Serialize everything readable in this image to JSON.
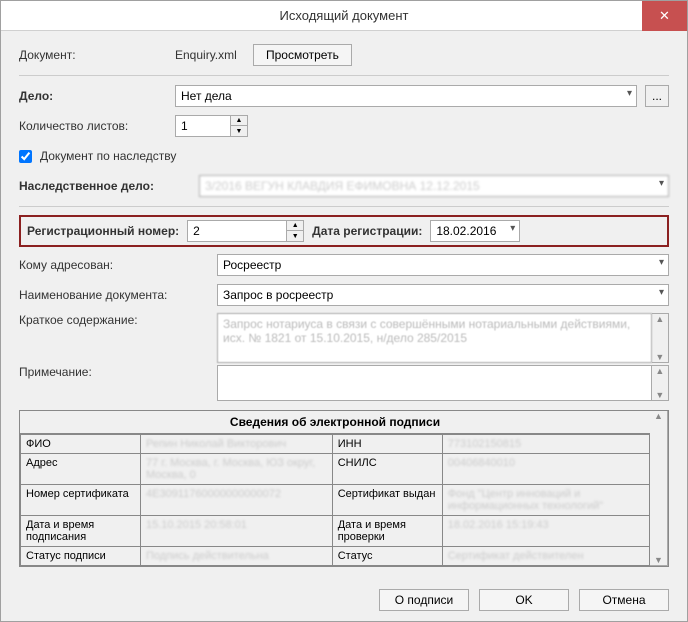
{
  "window": {
    "title": "Исходящий документ"
  },
  "doc": {
    "label": "Документ:",
    "filename": "Enquiry.xml",
    "view_btn": "Просмотреть"
  },
  "case": {
    "label": "Дело:",
    "value": "Нет дела"
  },
  "sheets": {
    "label": "Количество листов:",
    "value": "1"
  },
  "inherit": {
    "label": "Документ по наследству"
  },
  "inherit_case": {
    "label": "Наследственное дело:",
    "value": "3/2016 ВЕГУН КЛАВДИЯ ЕФИМОВНА 12.12.2015"
  },
  "reg": {
    "num_label": "Регистрационный номер:",
    "num_value": "2",
    "date_label": "Дата регистрации:",
    "date_value": "18.02.2016"
  },
  "addr": {
    "label": "Кому адресован:",
    "value": "Росреестр"
  },
  "docname": {
    "label": "Наименование документа:",
    "value": "Запрос в росреестр"
  },
  "summary": {
    "label": "Краткое содержание:",
    "value": "Запрос нотариуса в связи с совершёнными нотариальными действиями, исх. № 1821 от 15.10.2015, н/дело 285/2015"
  },
  "note": {
    "label": "Примечание:",
    "value": ""
  },
  "sig": {
    "title": "Сведения об электронной подписи",
    "rows": [
      {
        "l1": "ФИО",
        "v1": "Репин Николай Викторович",
        "l2": "ИНН",
        "v2": "773102150815"
      },
      {
        "l1": "Адрес",
        "v1": "77 г. Москва, г. Москва, ЮЗ округ, Москва, 0",
        "l2": "СНИЛС",
        "v2": "00406840010"
      },
      {
        "l1": "Номер сертификата",
        "v1": "4E30911760000000000072",
        "l2": "Сертификат выдан",
        "v2": "Фонд \"Центр инноваций и информационных технологий\""
      },
      {
        "l1": "Дата и время подписания",
        "v1": "15.10.2015 20:58:01",
        "l2": "Дата и время проверки",
        "v2": "18.02.2016 15:19:43"
      },
      {
        "l1": "Статус подписи",
        "v1": "Подпись действительна",
        "l2": "Статус",
        "v2": "Сертификат действителен"
      }
    ]
  },
  "footer": {
    "about": "О подписи",
    "ok": "OK",
    "cancel": "Отмена"
  }
}
